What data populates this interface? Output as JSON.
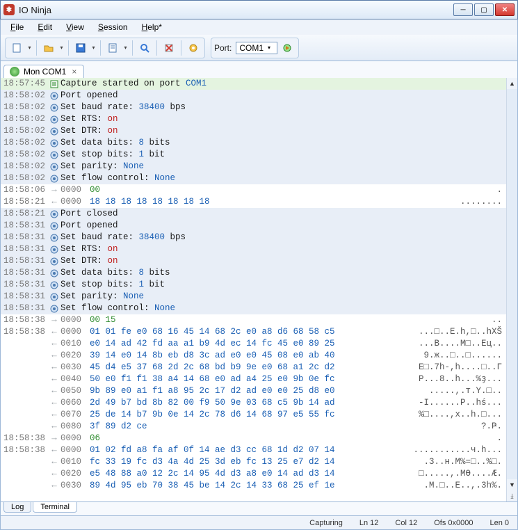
{
  "window": {
    "title": "IO Ninja"
  },
  "menu": {
    "file": "File",
    "edit": "Edit",
    "view": "View",
    "session": "Session",
    "help": "Help*"
  },
  "toolbar": {
    "port_label": "Port:",
    "port_value": "COM1"
  },
  "tabs": [
    {
      "label": "Mon COM1"
    }
  ],
  "bottom_tabs": {
    "log": "Log",
    "terminal": "Terminal"
  },
  "status": {
    "capturing": "Capturing",
    "ln": "Ln 12",
    "col": "Col 12",
    "ofs": "Ofs 0x0000",
    "len": "Len 0"
  },
  "log": [
    {
      "t": "18:57:45",
      "kind": "banner",
      "icon": "page",
      "body": [
        [
          "key",
          "Capture started on port "
        ],
        [
          "port",
          "COM1"
        ]
      ]
    },
    {
      "t": "18:58:02",
      "kind": "cfg",
      "icon": "cfg",
      "body": [
        [
          "key",
          "Port opened"
        ]
      ]
    },
    {
      "t": "18:58:02",
      "kind": "cfg",
      "icon": "cfg",
      "body": [
        [
          "key",
          "Set baud rate: "
        ],
        [
          "num",
          "38400"
        ],
        [
          "key",
          " bps"
        ]
      ]
    },
    {
      "t": "18:58:02",
      "kind": "cfg",
      "icon": "cfg",
      "body": [
        [
          "key",
          "Set RTS: "
        ],
        [
          "on",
          "on"
        ]
      ]
    },
    {
      "t": "18:58:02",
      "kind": "cfg",
      "icon": "cfg",
      "body": [
        [
          "key",
          "Set DTR: "
        ],
        [
          "on",
          "on"
        ]
      ]
    },
    {
      "t": "18:58:02",
      "kind": "cfg",
      "icon": "cfg",
      "body": [
        [
          "key",
          "Set data bits: "
        ],
        [
          "num",
          "8"
        ],
        [
          "key",
          " bits"
        ]
      ]
    },
    {
      "t": "18:58:02",
      "kind": "cfg",
      "icon": "cfg",
      "body": [
        [
          "key",
          "Set stop bits: "
        ],
        [
          "num",
          "1"
        ],
        [
          "key",
          " bit"
        ]
      ]
    },
    {
      "t": "18:58:02",
      "kind": "cfg",
      "icon": "cfg",
      "body": [
        [
          "key",
          "Set parity: "
        ],
        [
          "none",
          "None"
        ]
      ]
    },
    {
      "t": "18:58:02",
      "kind": "cfg",
      "icon": "cfg",
      "body": [
        [
          "key",
          "Set flow control: "
        ],
        [
          "none",
          "None"
        ]
      ]
    },
    {
      "t": "18:58:06",
      "kind": "hex",
      "dir": "out",
      "offset": "0000",
      "bytes": "00",
      "g": true,
      "ascii": "."
    },
    {
      "t": "18:58:21",
      "kind": "hex",
      "dir": "in",
      "offset": "0000",
      "bytes": "18 18 18 18 18 18 18 18",
      "ascii": "........"
    },
    {
      "t": "18:58:21",
      "kind": "cfg",
      "icon": "cfg",
      "body": [
        [
          "key",
          "Port closed"
        ]
      ]
    },
    {
      "t": "18:58:31",
      "kind": "cfg",
      "icon": "cfg",
      "body": [
        [
          "key",
          "Port opened"
        ]
      ]
    },
    {
      "t": "18:58:31",
      "kind": "cfg",
      "icon": "cfg",
      "body": [
        [
          "key",
          "Set baud rate: "
        ],
        [
          "num",
          "38400"
        ],
        [
          "key",
          " bps"
        ]
      ]
    },
    {
      "t": "18:58:31",
      "kind": "cfg",
      "icon": "cfg",
      "body": [
        [
          "key",
          "Set RTS: "
        ],
        [
          "on",
          "on"
        ]
      ]
    },
    {
      "t": "18:58:31",
      "kind": "cfg",
      "icon": "cfg",
      "body": [
        [
          "key",
          "Set DTR: "
        ],
        [
          "on",
          "on"
        ]
      ]
    },
    {
      "t": "18:58:31",
      "kind": "cfg",
      "icon": "cfg",
      "body": [
        [
          "key",
          "Set data bits: "
        ],
        [
          "num",
          "8"
        ],
        [
          "key",
          " bits"
        ]
      ]
    },
    {
      "t": "18:58:31",
      "kind": "cfg",
      "icon": "cfg",
      "body": [
        [
          "key",
          "Set stop bits: "
        ],
        [
          "num",
          "1"
        ],
        [
          "key",
          " bit"
        ]
      ]
    },
    {
      "t": "18:58:31",
      "kind": "cfg",
      "icon": "cfg",
      "body": [
        [
          "key",
          "Set parity: "
        ],
        [
          "none",
          "None"
        ]
      ]
    },
    {
      "t": "18:58:31",
      "kind": "cfg",
      "icon": "cfg",
      "body": [
        [
          "key",
          "Set flow control: "
        ],
        [
          "none",
          "None"
        ]
      ]
    },
    {
      "t": "18:58:38",
      "kind": "hex",
      "dir": "out",
      "offset": "0000",
      "bytes": "00 15",
      "g": true,
      "ascii": ".."
    },
    {
      "t": "18:58:38",
      "kind": "hex",
      "dir": "in",
      "offset": "0000",
      "bytes": "01 01 fe e0 68 16 45 14 68 2c e0 a8 d6 68 58 c5",
      "ascii": "...□..E.h,□..hXŠ"
    },
    {
      "t": "",
      "kind": "hex",
      "dir": "in",
      "offset": "0010",
      "bytes": "e0 14 ad 42 fd aa a1 b9 4d ec 14 fc 45 e0 89 25",
      "ascii": "...B....M□..Eц.."
    },
    {
      "t": "",
      "kind": "hex",
      "dir": "in",
      "offset": "0020",
      "bytes": "39 14 e0 14 8b eb d8 3c ad e0 e0 45 08 e0 ab 40",
      "ascii": "9.ж..□..□......"
    },
    {
      "t": "",
      "kind": "hex",
      "dir": "in",
      "offset": "0030",
      "bytes": "45 d4 e5 37 68 2d 2c 68 bd b9 9e e0 68 a1 2c d2",
      "ascii": "E□.7h-,h....□..Г"
    },
    {
      "t": "",
      "kind": "hex",
      "dir": "in",
      "offset": "0040",
      "bytes": "50 e0 f1 f1 38 a4 14 68 e0 ad a4 25 e0 9b 0e fc",
      "ascii": "P...8..h...%ҙ..."
    },
    {
      "t": "",
      "kind": "hex",
      "dir": "in",
      "offset": "0050",
      "bytes": "9b 89 e0 a1 f1 a8 95 2c 17 d2 ad e0 e0 25 d8 e0",
      "ascii": ".....,.т.Y.□.."
    },
    {
      "t": "",
      "kind": "hex",
      "dir": "in",
      "offset": "0060",
      "bytes": "2d 49 b7 bd 8b 82 00 f9 50 9e 03 68 c5 9b 14 ad",
      "ascii": "-I......P..hś..."
    },
    {
      "t": "",
      "kind": "hex",
      "dir": "in",
      "offset": "0070",
      "bytes": "25 de 14 b7 9b 0e 14 2c 78 d6 14 68 97 e5 55 fc",
      "ascii": "%□....,x..h.□..."
    },
    {
      "t": "",
      "kind": "hex",
      "dir": "in",
      "offset": "0080",
      "bytes": "3f 89 d2 ce",
      "ascii": "?.Ҏ."
    },
    {
      "t": "18:58:38",
      "kind": "hex",
      "dir": "out",
      "offset": "0000",
      "bytes": "06",
      "g": true,
      "ascii": "."
    },
    {
      "t": "18:58:38",
      "kind": "hex",
      "dir": "in",
      "offset": "0000",
      "bytes": "01 02 fd a8 fa af 0f 14 ae d3 cc 68 1d d2 07 14",
      "ascii": "...........ч.h..."
    },
    {
      "t": "",
      "kind": "hex",
      "dir": "in",
      "offset": "0010",
      "bytes": "fc 33 19 fc d3 4a 4d 25 3d eb fc 13 25 e7 d2 14",
      "ascii": ".3..н.M%=□..%□."
    },
    {
      "t": "",
      "kind": "hex",
      "dir": "in",
      "offset": "0020",
      "bytes": "e5 48 88 a0 12 2c 14 95 4d d3 a8 e0 14 ad d3 14",
      "ascii": "□.....,.MӨ....Æ."
    },
    {
      "t": "",
      "kind": "hex",
      "dir": "in",
      "offset": "0030",
      "bytes": "89 4d 95 eb 70 38 45 be 14 2c 14 33 68 25 ef 1e",
      "ascii": ".M.□..E..,.3h%."
    }
  ]
}
